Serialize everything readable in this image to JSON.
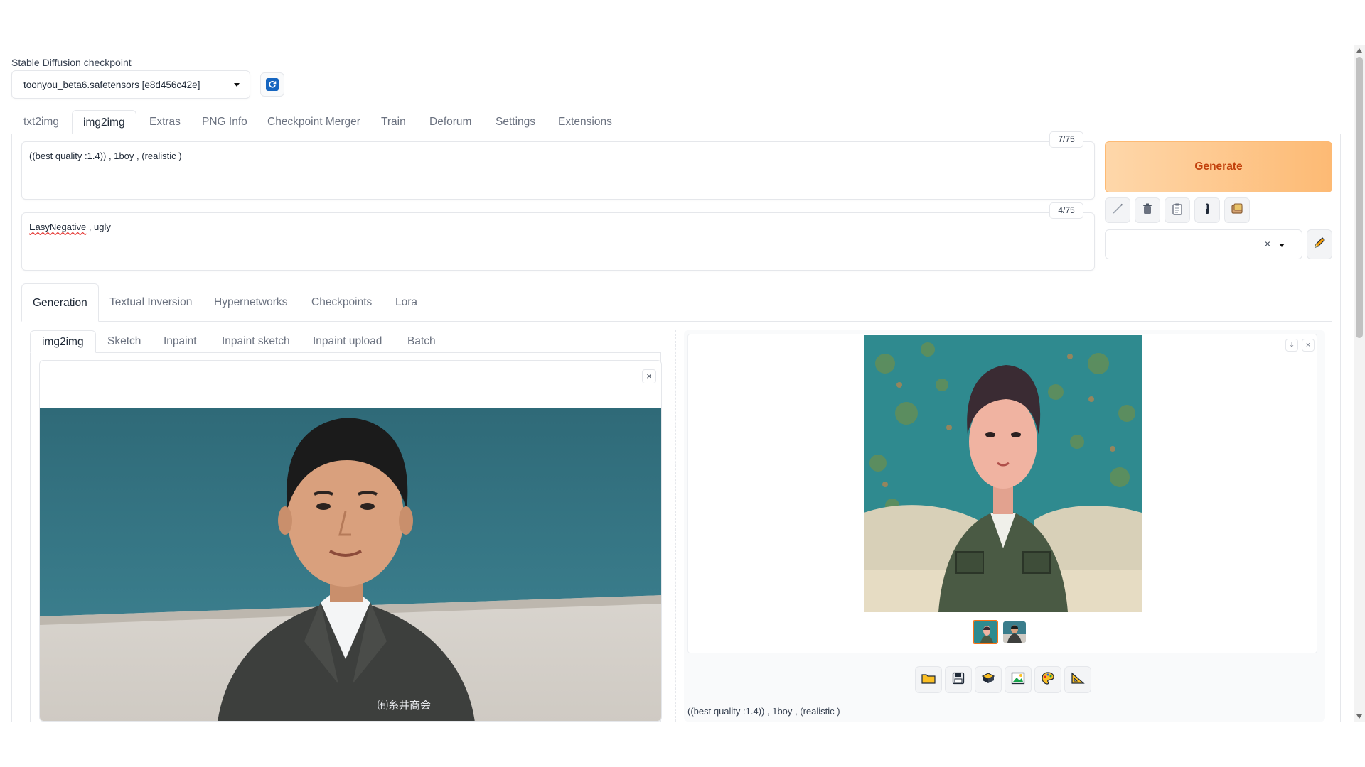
{
  "checkpoint": {
    "label": "Stable Diffusion checkpoint",
    "value": "toonyou_beta6.safetensors [e8d456c42e]",
    "refresh_icon": "refresh-icon"
  },
  "main_tabs": [
    "txt2img",
    "img2img",
    "Extras",
    "PNG Info",
    "Checkpoint Merger",
    "Train",
    "Deforum",
    "Settings",
    "Extensions"
  ],
  "active_main_tab": "img2img",
  "prompt": {
    "text": "((best quality :1.4)) , 1boy  , (realistic )",
    "token_count": "7/75"
  },
  "negative_prompt": {
    "text_part1": "EasyNegative",
    "text_part2": " , ugly",
    "token_count": "4/75"
  },
  "generate": {
    "label": "Generate",
    "accent": "#fdba74",
    "text_color": "#c2410c"
  },
  "tool_buttons": [
    "paint-brush-icon",
    "trash-icon",
    "clipboard-icon",
    "stick-icon",
    "styles-box-icon"
  ],
  "style_select": {
    "clear_symbol": "×",
    "edit_icon": "pencil-icon"
  },
  "sub_tabs": [
    "Generation",
    "Textual Inversion",
    "Hypernetworks",
    "Checkpoints",
    "Lora"
  ],
  "active_sub_tab": "Generation",
  "inner_tabs": [
    "img2img",
    "Sketch",
    "Inpaint",
    "Inpaint sketch",
    "Inpaint upload",
    "Batch"
  ],
  "active_inner_tab": "img2img",
  "input_image": {
    "description_icon": "portrait-photo",
    "close_symbol": "×",
    "jacket_text": "㈲糸井商会"
  },
  "output": {
    "download_symbol": "⤓",
    "close_symbol": "×",
    "thumbnail_count": 2,
    "action_buttons": [
      "folder-icon",
      "save-icon",
      "zip-icon",
      "send-to-img2img-icon",
      "send-to-inpaint-icon",
      "send-to-extras-icon"
    ],
    "prompt_text": "((best quality :1.4)) , 1boy , (realistic )"
  }
}
